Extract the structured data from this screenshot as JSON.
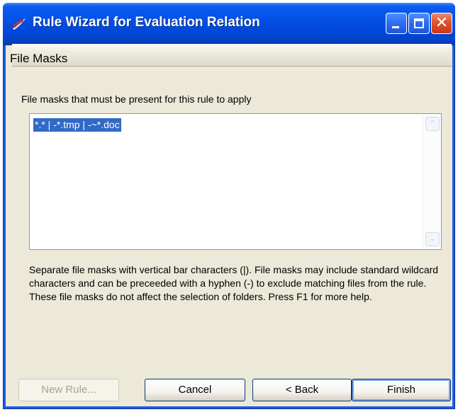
{
  "window": {
    "title": "Rule Wizard for Evaluation Relation",
    "app_icon": "rule-wizard-icon",
    "controls": {
      "minimize_icon": "minimize-icon",
      "maximize_icon": "maximize-icon",
      "close_icon": "close-icon",
      "close_glyph": "✕"
    }
  },
  "page": {
    "header_title": "File Masks",
    "field_label": "File masks that must be present for this rule to apply",
    "file_masks_value": "*.* | -*.tmp | -~*.doc",
    "help_text": "Separate file masks with vertical bar characters (|).  File masks may include standard wildcard characters and can be preceeded with a hyphen (-) to exclude matching files from the rule. These file masks do not affect the selection of folders.  Press F1 for more help."
  },
  "scrollbar": {
    "up_glyph": "⌃",
    "down_glyph": "⌄"
  },
  "buttons": {
    "new_rule": "New Rule...",
    "cancel": "Cancel",
    "back": "< Back",
    "finish": "Finish"
  },
  "colors": {
    "titlebar": "#0550e6",
    "dialog_background": "#ece9d8",
    "selection": "#316ac5",
    "close_button": "#e0532c"
  }
}
